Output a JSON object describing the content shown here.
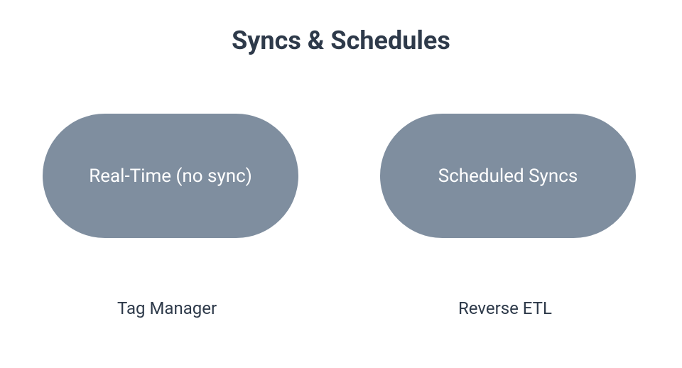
{
  "title": "Syncs & Schedules",
  "pills": {
    "left": {
      "label": "Real-Time (no sync)",
      "caption": "Tag Manager"
    },
    "right": {
      "label": "Scheduled Syncs",
      "caption": "Reverse ETL"
    }
  },
  "colors": {
    "text_primary": "#2e3a4a",
    "pill_bg": "#7f8e9f",
    "pill_text": "#ffffff",
    "page_bg": "#ffffff"
  }
}
